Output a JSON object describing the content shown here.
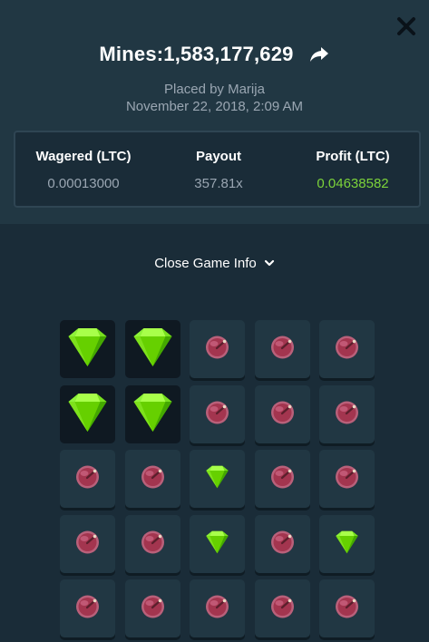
{
  "bet": {
    "title": "Mines:1,583,177,629",
    "placed_by": "Placed by Marija",
    "date": "November 22, 2018, 2:09 AM"
  },
  "stats": {
    "wagered_label": "Wagered (LTC)",
    "wagered_value": "0.00013000",
    "payout_label": "Payout",
    "payout_value": "357.81x",
    "profit_label": "Profit (LTC)",
    "profit_value": "0.04638582"
  },
  "toggle": {
    "label": "Close Game Info",
    "icon": "chevron-down-icon"
  },
  "icons": {
    "close": "close-icon",
    "share": "share-arrow-icon"
  },
  "colors": {
    "background": "#1a2c38",
    "header": "#213743",
    "profit_green": "#7cd33a",
    "gem_green": "#6fe000",
    "mine_red": "#a3354f"
  },
  "board": {
    "size": 5,
    "tiles": [
      [
        "gem-revealed",
        "gem-revealed",
        "mine",
        "mine",
        "mine"
      ],
      [
        "gem-revealed",
        "gem-revealed",
        "mine",
        "mine",
        "mine"
      ],
      [
        "mine",
        "mine",
        "gem",
        "mine",
        "mine"
      ],
      [
        "mine",
        "mine",
        "gem",
        "mine",
        "gem"
      ],
      [
        "mine",
        "mine",
        "mine",
        "mine",
        "mine"
      ]
    ]
  }
}
